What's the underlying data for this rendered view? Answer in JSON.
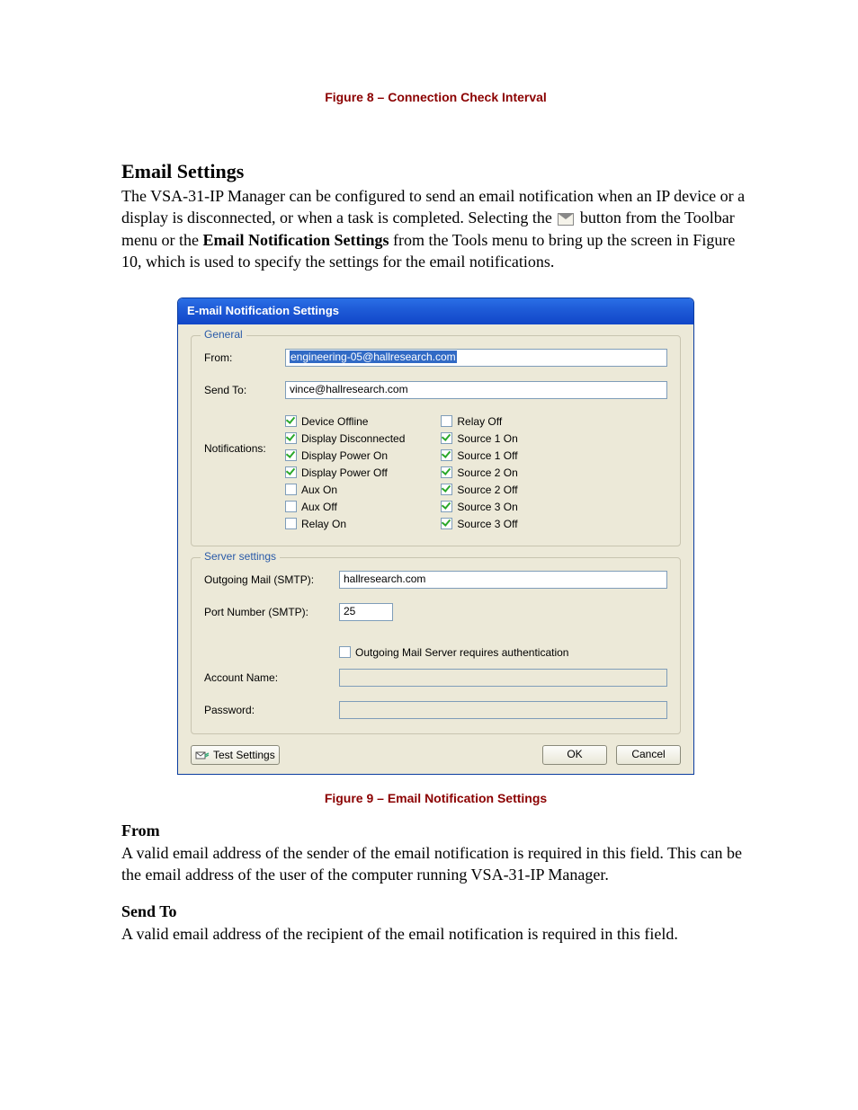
{
  "captions": {
    "fig8": "Figure 8 – Connection Check Interval",
    "fig9": "Figure 9 – Email Notification Settings"
  },
  "section": {
    "title": "Email Settings",
    "intro_a": "The VSA-31-IP Manager can be configured to send an email notification when an IP device or a display is disconnected, or when a task is completed.  Selecting the ",
    "intro_b": " button from the Toolbar menu or the ",
    "intro_bold": "Email Notification Settings",
    "intro_c": " from the Tools menu to bring up the screen in Figure 10, which is used to specify the settings for the email notifications."
  },
  "dialog": {
    "title": "E-mail Notification Settings",
    "general": {
      "legend": "General",
      "from_label": "From:",
      "from_value": "engineering-05@hallresearch.com",
      "sendto_label": "Send To:",
      "sendto_value": "vince@hallresearch.com",
      "notifications_label": "Notifications:",
      "col1": [
        {
          "label": "Device Offline",
          "checked": true
        },
        {
          "label": "Display Disconnected",
          "checked": true
        },
        {
          "label": "Display Power On",
          "checked": true
        },
        {
          "label": "Display Power Off",
          "checked": true
        },
        {
          "label": "Aux On",
          "checked": false
        },
        {
          "label": "Aux Off",
          "checked": false
        },
        {
          "label": "Relay On",
          "checked": false
        }
      ],
      "col2": [
        {
          "label": "Relay Off",
          "checked": false
        },
        {
          "label": "Source 1 On",
          "checked": true
        },
        {
          "label": "Source 1 Off",
          "checked": true
        },
        {
          "label": "Source 2 On",
          "checked": true
        },
        {
          "label": "Source 2 Off",
          "checked": true
        },
        {
          "label": "Source 3 On",
          "checked": true
        },
        {
          "label": "Source 3 Off",
          "checked": true
        }
      ]
    },
    "server": {
      "legend": "Server settings",
      "smtp_label": "Outgoing Mail (SMTP):",
      "smtp_value": "hallresearch.com",
      "port_label": "Port Number (SMTP):",
      "port_value": "25",
      "auth_label": "Outgoing Mail Server requires authentication",
      "auth_checked": false,
      "account_label": "Account Name:",
      "account_value": "",
      "password_label": "Password:",
      "password_value": ""
    },
    "buttons": {
      "test": "Test Settings",
      "ok": "OK",
      "cancel": "Cancel"
    }
  },
  "descriptions": {
    "from_head": "From",
    "from_body": "A valid email address of the sender of the email notification is required in this field. This can be the email address of the user of the computer running VSA-31-IP Manager.",
    "sendto_head": "Send To",
    "sendto_body": "A valid email address of the recipient of the email notification is required in this field."
  }
}
